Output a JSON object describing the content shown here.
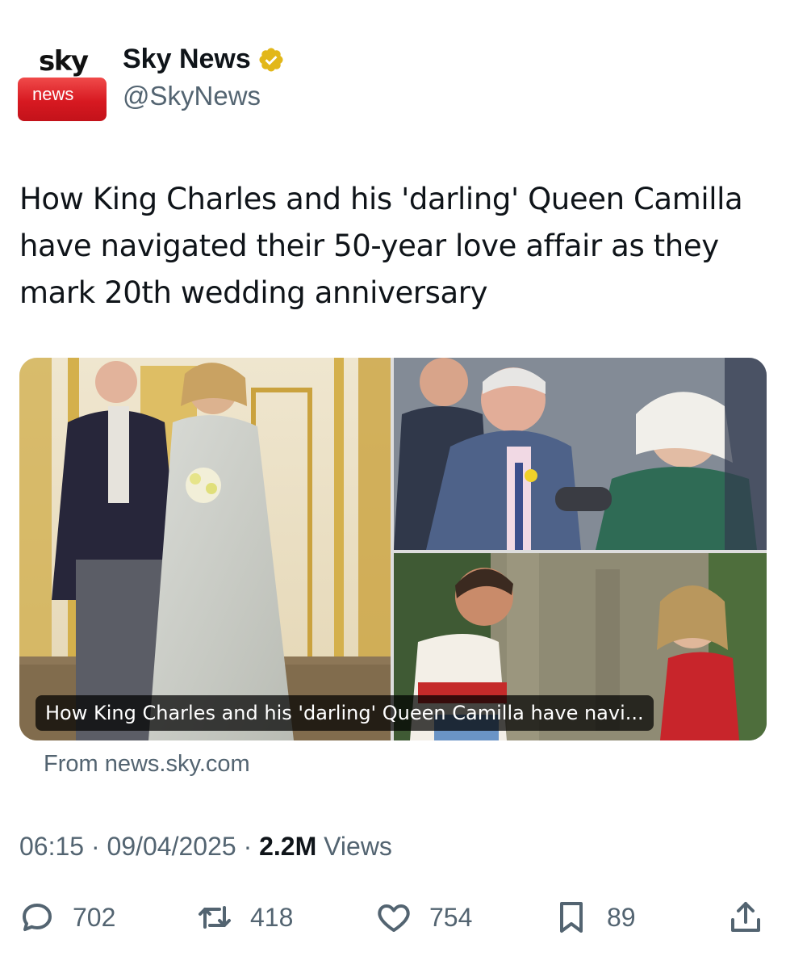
{
  "author": {
    "logo_top": "sky",
    "logo_bottom": "news",
    "display_name": "Sky News",
    "handle": "@SkyNews"
  },
  "tweet": {
    "text": "How King Charles and his 'darling' Queen Camilla have navigated their 50-year love affair as they mark 20th wedding anniversary"
  },
  "link_card": {
    "caption": "How King Charles and his 'darling' Queen Camilla have navi...",
    "source": "From news.sky.com"
  },
  "meta": {
    "time": "06:15",
    "date": "09/04/2025",
    "views_count": "2.2M",
    "views_label": "Views"
  },
  "actions": {
    "replies": "702",
    "reposts": "418",
    "likes": "754",
    "bookmarks": "89"
  },
  "colors": {
    "text_primary": "#0f1419",
    "text_secondary": "#536471",
    "sky_red": "#d71921",
    "verified_gold": "#e2b719"
  },
  "icons": [
    "verified-badge-icon",
    "reply-icon",
    "repost-icon",
    "like-icon",
    "bookmark-icon",
    "share-icon"
  ]
}
